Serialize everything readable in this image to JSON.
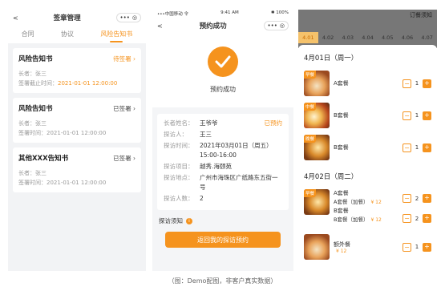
{
  "screen1": {
    "back": "<",
    "title": "签章管理",
    "capsule_more": "•••",
    "capsule_close": "◎",
    "tabs": [
      "合同",
      "协议",
      "风险告知书"
    ],
    "cards": [
      {
        "title": "风险告知书",
        "status": "待签署",
        "line1": "长者：张三",
        "line2_label": "签署截止时间：",
        "line2_value": "2021-01-01 12:00:00"
      },
      {
        "title": "风险告知书",
        "status": "已签署",
        "line1": "长者：张三",
        "line2_label": "签署时间：",
        "line2_value": "2021-01-01 12:00:00"
      },
      {
        "title": "其他XXX告知书",
        "status": "已签署",
        "line1": "长者：张三",
        "line2_label": "签署时间：",
        "line2_value": "2021-01-01 12:00:00"
      }
    ]
  },
  "screen2": {
    "statusbar_left": "•••中国移动 令",
    "statusbar_mid": "9:41 AM",
    "statusbar_right": "✱ 100%",
    "back": "<",
    "title": "预约成功",
    "success_text": "预约成功",
    "rows": [
      {
        "label": "长者姓名：",
        "value": "王爷爷"
      },
      {
        "label": "探访人：",
        "value": "王三"
      },
      {
        "label": "探访时间：",
        "value": "2021年03月01日（周五）15:00-16:00"
      },
      {
        "label": "探访项目：",
        "value": "越秀.海颐苑"
      },
      {
        "label": "探访地点：",
        "value": "广州市海珠区广纸路东五街一号"
      },
      {
        "label": "探访人数：",
        "value": "2"
      }
    ],
    "tag": "已预约",
    "notice": "探访须知",
    "notice_icon": "i",
    "button": "返回我的探访预约"
  },
  "screen3": {
    "top_title": "订餐须知",
    "dates": [
      "4.01",
      "4.02",
      "4.03",
      "4.04",
      "4.05",
      "4.06",
      "4.07"
    ],
    "day1": "4月01日（周一）",
    "day2": "4月02日（周二）",
    "meals_day1": [
      {
        "badge": "早餐",
        "name": "A套餐",
        "qty": "1"
      },
      {
        "badge": "中餐",
        "name": "B套餐",
        "qty": "1"
      },
      {
        "badge": "晚餐",
        "name": "B套餐",
        "qty": "1"
      }
    ],
    "day2_breakfast": {
      "badge": "早餐",
      "lines": [
        {
          "name": "A套餐",
          "sub": "A套餐（加餐）",
          "price": "¥ 12",
          "qty": "2"
        },
        {
          "name": "B套餐",
          "sub": "B套餐（加餐）",
          "price": "¥ 12",
          "qty": "2"
        }
      ]
    },
    "day2_extra": {
      "name": "额外餐",
      "price": "¥ 12",
      "qty": "1"
    },
    "minus": "−",
    "plus": "+"
  },
  "caption": "（图：Demo配图，非客户真实数据）",
  "colors": {
    "accent": "#f5931e",
    "bg": "#f2f3f5"
  }
}
